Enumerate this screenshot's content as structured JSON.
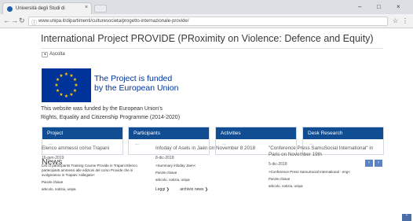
{
  "browser": {
    "tab_title": "Università degli Studi di",
    "tab_close": "×",
    "url": "www.unipa.it/dipartimenti/culturesocieta/progetto-internazionale-provide/",
    "window_controls": [
      "–",
      "□",
      "×"
    ]
  },
  "page": {
    "title": "International Project PROVIDE (PRoximity on Violence: Defence and Equity)",
    "listen_label": "Ascolta",
    "eu_banner_text_line1": "The Project is funded",
    "eu_banner_text_line2": "by the European Union",
    "funded_line1": "This website was funded by the European Union's",
    "funded_line2": "Rights, Equality and Citizenship Programme (2014-2020)"
  },
  "cards": [
    {
      "title": "Project",
      "body": "---"
    },
    {
      "title": "Participants",
      "body": "---"
    },
    {
      "title": "Activities",
      "body": "---"
    },
    {
      "title": "Desk Research",
      "body": "---"
    }
  ],
  "news": {
    "heading": "News",
    "prev": "‹",
    "next": "›",
    "items": [
      {
        "title": "Elenco ammessi corso Trapani",
        "date": "16-gen-2019",
        "body": "List of participants Training Course Provide in Trapani Elenco partecipanti ammessi alle edizioni del corso Provide che si svolgeranno in Trapani >allegato<",
        "keywords_label": "Parole chiave",
        "keywords": "articolo, notizia, unipa",
        "links": []
      },
      {
        "title": "Infoday of Asels in Jaén on November 8 2018",
        "date": "8-dic-2018",
        "body": ">Summary infoday Jaen<",
        "keywords_label": "Parole chiave",
        "keywords": "articolo, notizia, unipa",
        "links": [
          "Leggi ❯",
          "archivio news ❯"
        ]
      },
      {
        "title": "\"Conference Press SamuSocial International\" in Paris on November 19th",
        "date": "5-dic-2018",
        "body": ">Conference Press SamuSocial International - eng<",
        "keywords_label": "Parole chiave",
        "keywords": "articolo, notizia, unipa",
        "links": []
      }
    ]
  },
  "colors": {
    "eu_blue": "#003399",
    "eu_star": "#ffcc00",
    "card_header": "#104d92",
    "arrow_blue": "#5b83c4"
  },
  "icons": {
    "favicon": "university-favicon-icon",
    "back": "back-arrow-icon",
    "forward": "forward-arrow-icon",
    "reload": "reload-icon",
    "secure": "info-icon",
    "bookmark": "star-icon",
    "listen": "speaker-icon",
    "scroll_top": "chevron-up-icon"
  }
}
